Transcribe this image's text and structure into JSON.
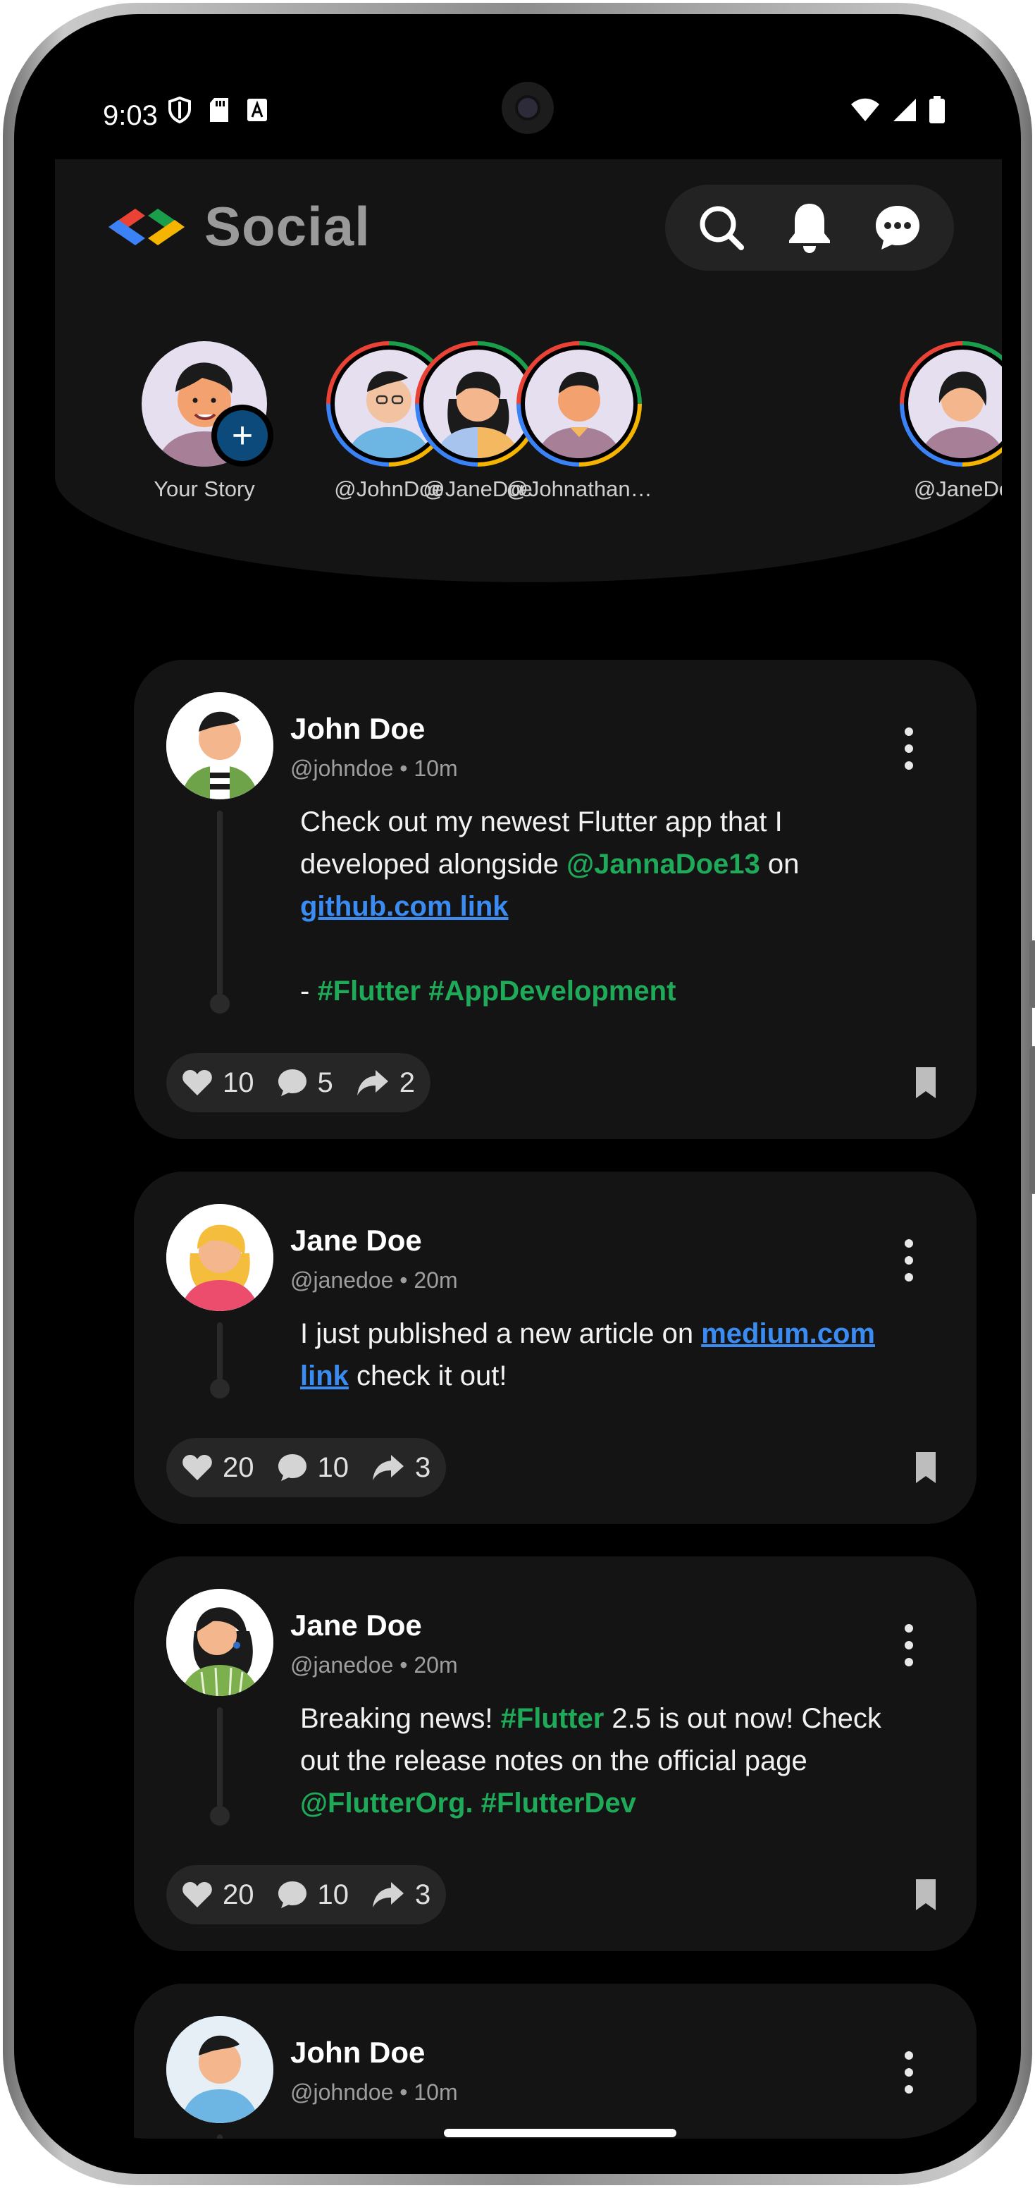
{
  "status_bar": {
    "time": "9:03"
  },
  "app": {
    "title": "Social"
  },
  "header_actions": [
    "search-icon",
    "bell-icon",
    "messages-icon"
  ],
  "stories": [
    {
      "label": "Your Story",
      "is_own": true,
      "add_icon": "+"
    },
    {
      "label": "@JohnDoe"
    },
    {
      "label": "@JaneDoe"
    },
    {
      "label": "@Johnathan…"
    },
    {
      "label": "@JaneDo"
    }
  ],
  "posts": [
    {
      "name": "John Doe",
      "handle": "@johndoe",
      "sep": "•",
      "time": "10m",
      "body": {
        "l1": "Check out my newest Flutter app that I",
        "l2a": "developed alongside ",
        "mention": "@JannaDoe13",
        "l2b": " on",
        "link": "github.com link",
        "dash": "- ",
        "tags": "#Flutter #AppDevelopment"
      },
      "likes": "10",
      "comments": "5",
      "shares": "2"
    },
    {
      "name": "Jane Doe",
      "handle": "@janedoe",
      "sep": "•",
      "time": "20m",
      "body": {
        "l1": "I just published a new article on ",
        "link1": "medium.com",
        "link2": "link",
        "l2": " check it out!"
      },
      "likes": "20",
      "comments": "10",
      "shares": "3"
    },
    {
      "name": "Jane Doe",
      "handle": "@janedoe",
      "sep": "•",
      "time": "20m",
      "body": {
        "l1a": "Breaking news! ",
        "tag1": "#Flutter",
        "l1b": " 2.5 is out now! Check",
        "l2": "out the release notes on the official page",
        "tags": "@FlutterOrg. #FlutterDev"
      },
      "likes": "20",
      "comments": "10",
      "shares": "3"
    },
    {
      "name": "John Doe",
      "handle": "@johndoe",
      "sep": "•",
      "time": "10m"
    }
  ],
  "colors": {
    "background": "#000000",
    "card": "#141414",
    "accent_green": "#1faa59",
    "link_blue": "#3b8cf2",
    "add_badge": "#0b4a7a"
  }
}
